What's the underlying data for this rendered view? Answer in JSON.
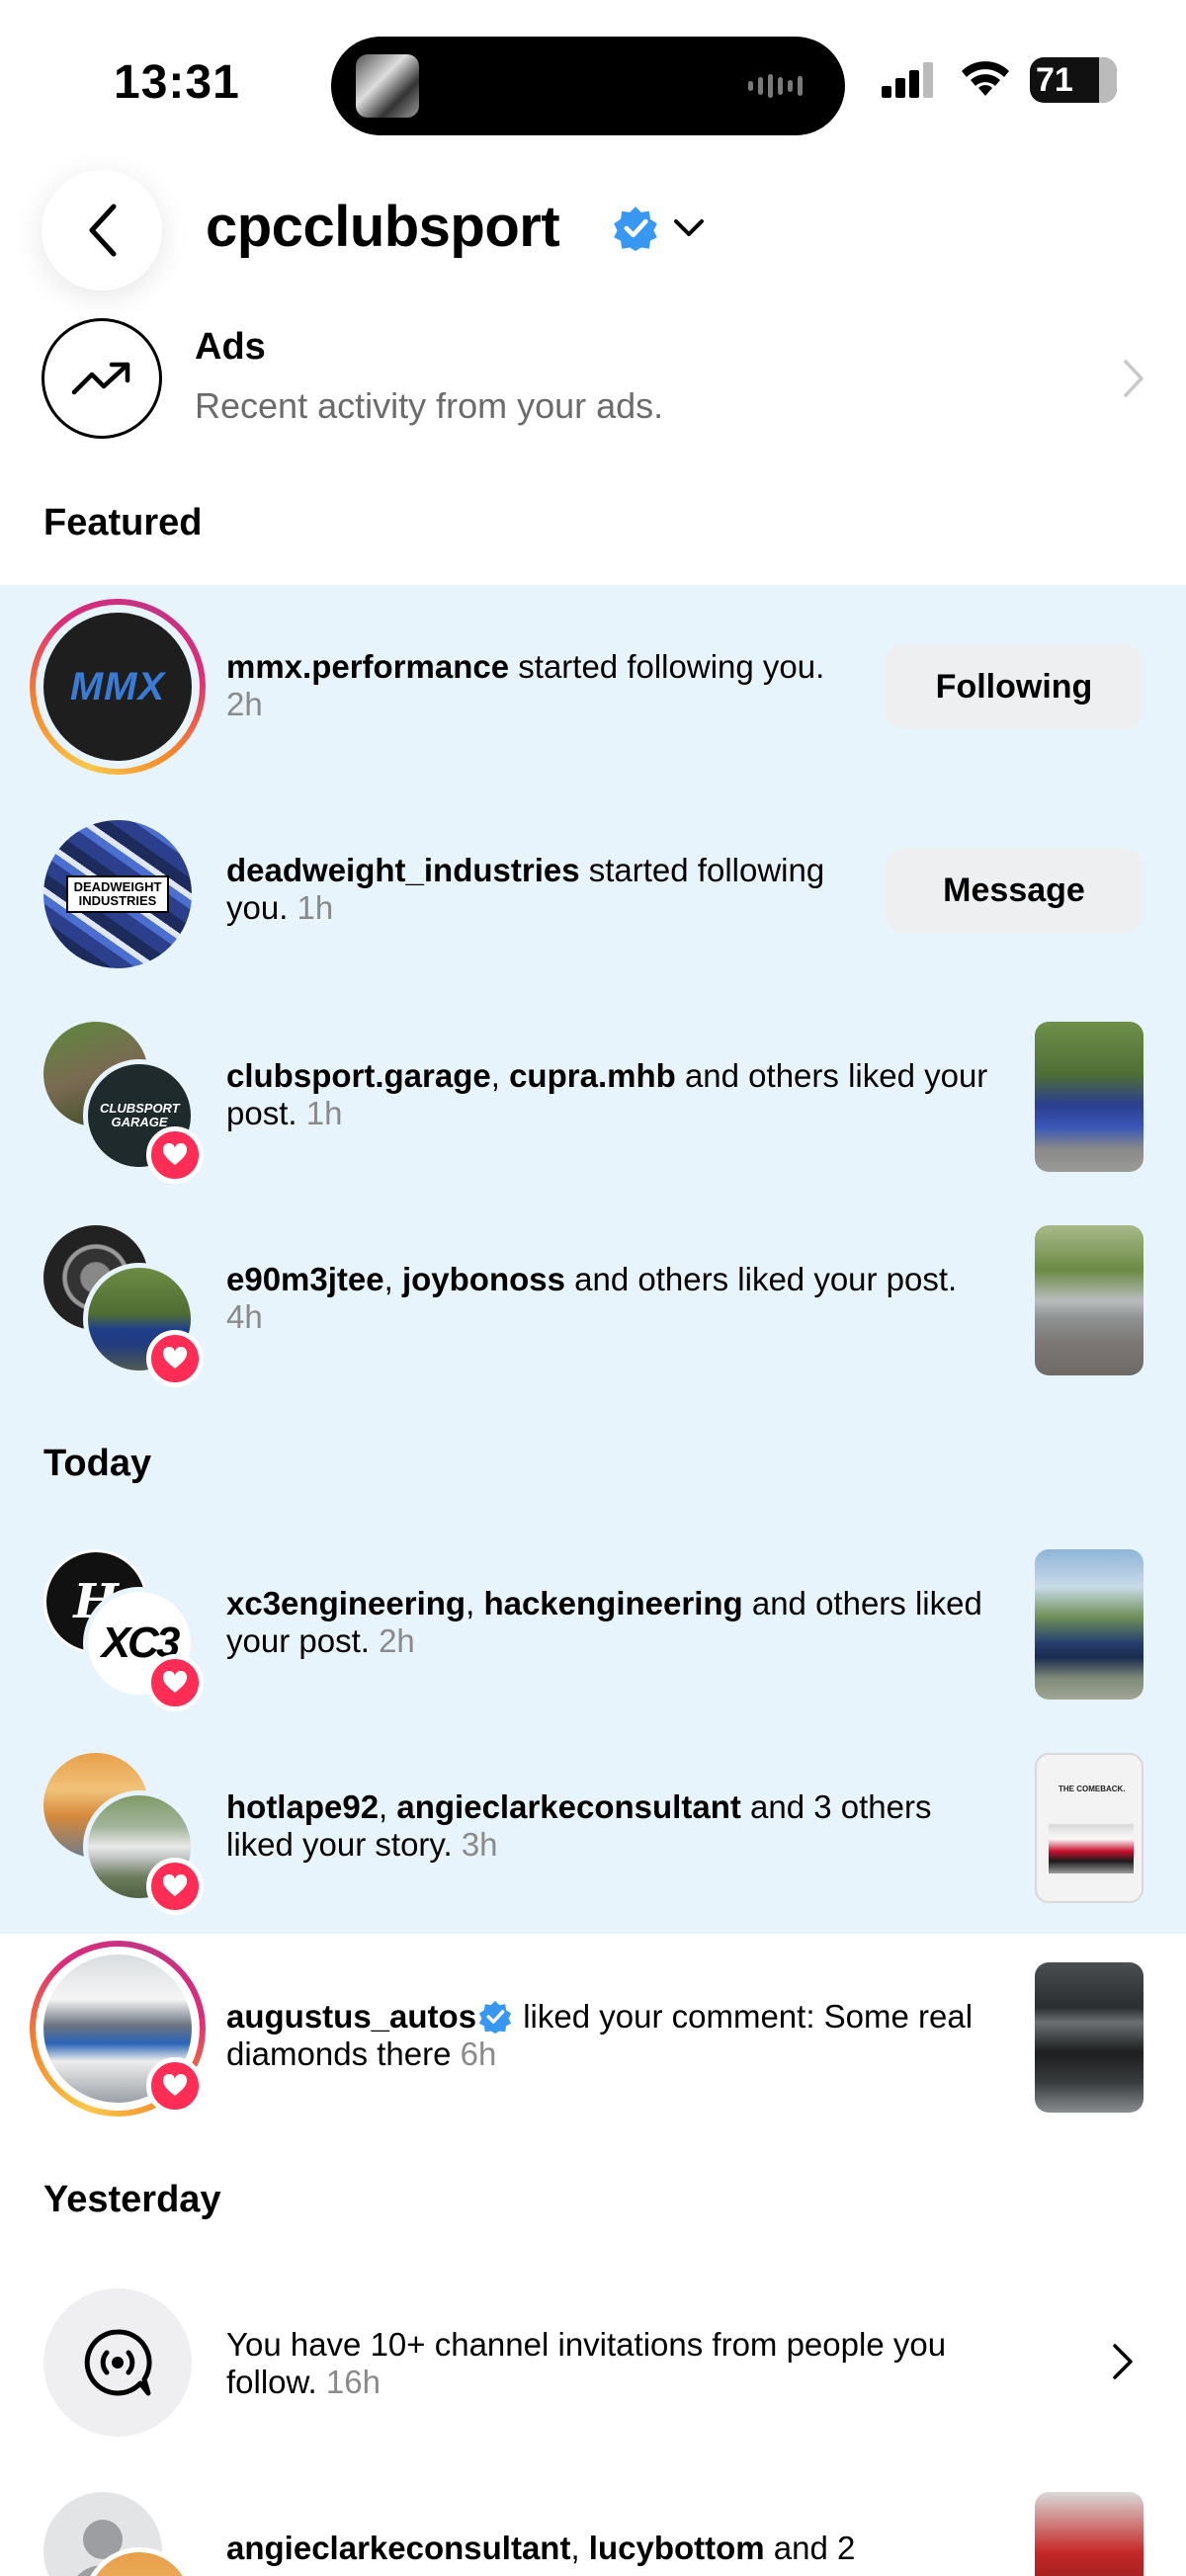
{
  "status_bar": {
    "time": "13:31",
    "battery": "71"
  },
  "header": {
    "account_name": "cpcclubsport"
  },
  "ads": {
    "title": "Ads",
    "subtitle": "Recent activity from your ads."
  },
  "sections": {
    "featured": "Featured",
    "today": "Today",
    "yesterday": "Yesterday"
  },
  "notifications": [
    {
      "users": [
        "mmx.performance"
      ],
      "text": " started following you. ",
      "time": "2h",
      "button": "Following",
      "avatar_text": "MMX"
    },
    {
      "users": [
        "deadweight_industries"
      ],
      "text": " started following you. ",
      "time": "1h",
      "button": "Message",
      "avatar_text": "DEADWEIGHT INDUSTRIES"
    },
    {
      "users": [
        "clubsport.garage",
        "cupra.mhb"
      ],
      "sep": ", ",
      "text": " and others liked your post. ",
      "time": "1h",
      "avatar_text": "CLUBSPORT GARAGE"
    },
    {
      "users": [
        "e90m3jtee",
        "joybonoss"
      ],
      "sep": ", ",
      "text": " and others liked your post. ",
      "time": "4h"
    },
    {
      "users": [
        "xc3engineering",
        "hackengineering"
      ],
      "sep": ", ",
      "text": " and others liked your post. ",
      "time": "2h",
      "avatar_text": "XC3"
    },
    {
      "users": [
        "hotlape92",
        "angieclarkeconsultant"
      ],
      "sep": ", ",
      "text": " and 3 others liked your story. ",
      "time": "3h",
      "thumb_text": "THE COMEBACK."
    },
    {
      "users": [
        "augustus_autos"
      ],
      "text": " liked your comment: Some real diamonds there ",
      "time": "6h"
    },
    {
      "text": "You have 10+ channel invitations from people you follow. ",
      "time": "16h"
    },
    {
      "users": [
        "angieclarkeconsultant",
        "lucybottom"
      ],
      "sep": ", ",
      "text": " and 2"
    }
  ],
  "colors": {
    "highlight_bg": "#e8f4fb",
    "verified": "#3897f0",
    "heart": "#ff2d55",
    "time_gray": "#8a8a8a"
  }
}
